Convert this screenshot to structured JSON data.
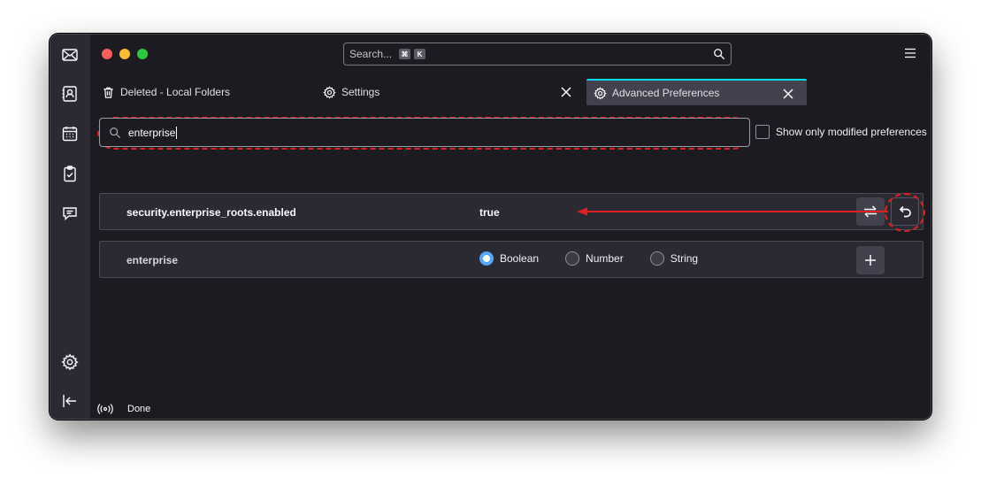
{
  "sidebar": {
    "items": [
      {
        "name": "mail-icon"
      },
      {
        "name": "address-book-icon"
      },
      {
        "name": "calendar-icon"
      },
      {
        "name": "tasks-icon"
      },
      {
        "name": "chat-icon"
      },
      {
        "name": "settings-icon"
      },
      {
        "name": "collapse-icon"
      }
    ]
  },
  "titlebar": {
    "search_placeholder": "Search...",
    "shortcut_cmd": "⌘",
    "shortcut_key": "K"
  },
  "tabs": [
    {
      "label": "Deleted - Local Folders",
      "icon": "trash-icon"
    },
    {
      "label": "Settings",
      "icon": "gear-icon"
    },
    {
      "label": "Advanced Preferences",
      "icon": "gear-icon",
      "active": true
    }
  ],
  "pref_search": {
    "value": "enterprise"
  },
  "modified_toggle": {
    "label": "Show only modified preferences",
    "checked": false
  },
  "prefs": [
    {
      "name": "security.enterprise_roots.enabled",
      "value": "true"
    }
  ],
  "new_pref": {
    "name": "enterprise",
    "types": [
      "Boolean",
      "Number",
      "String"
    ],
    "selected": "Boolean"
  },
  "status": {
    "text": "Done"
  },
  "colors": {
    "annotation": "#e02020",
    "accent": "#58a6ff",
    "background": "#1c1b22"
  }
}
